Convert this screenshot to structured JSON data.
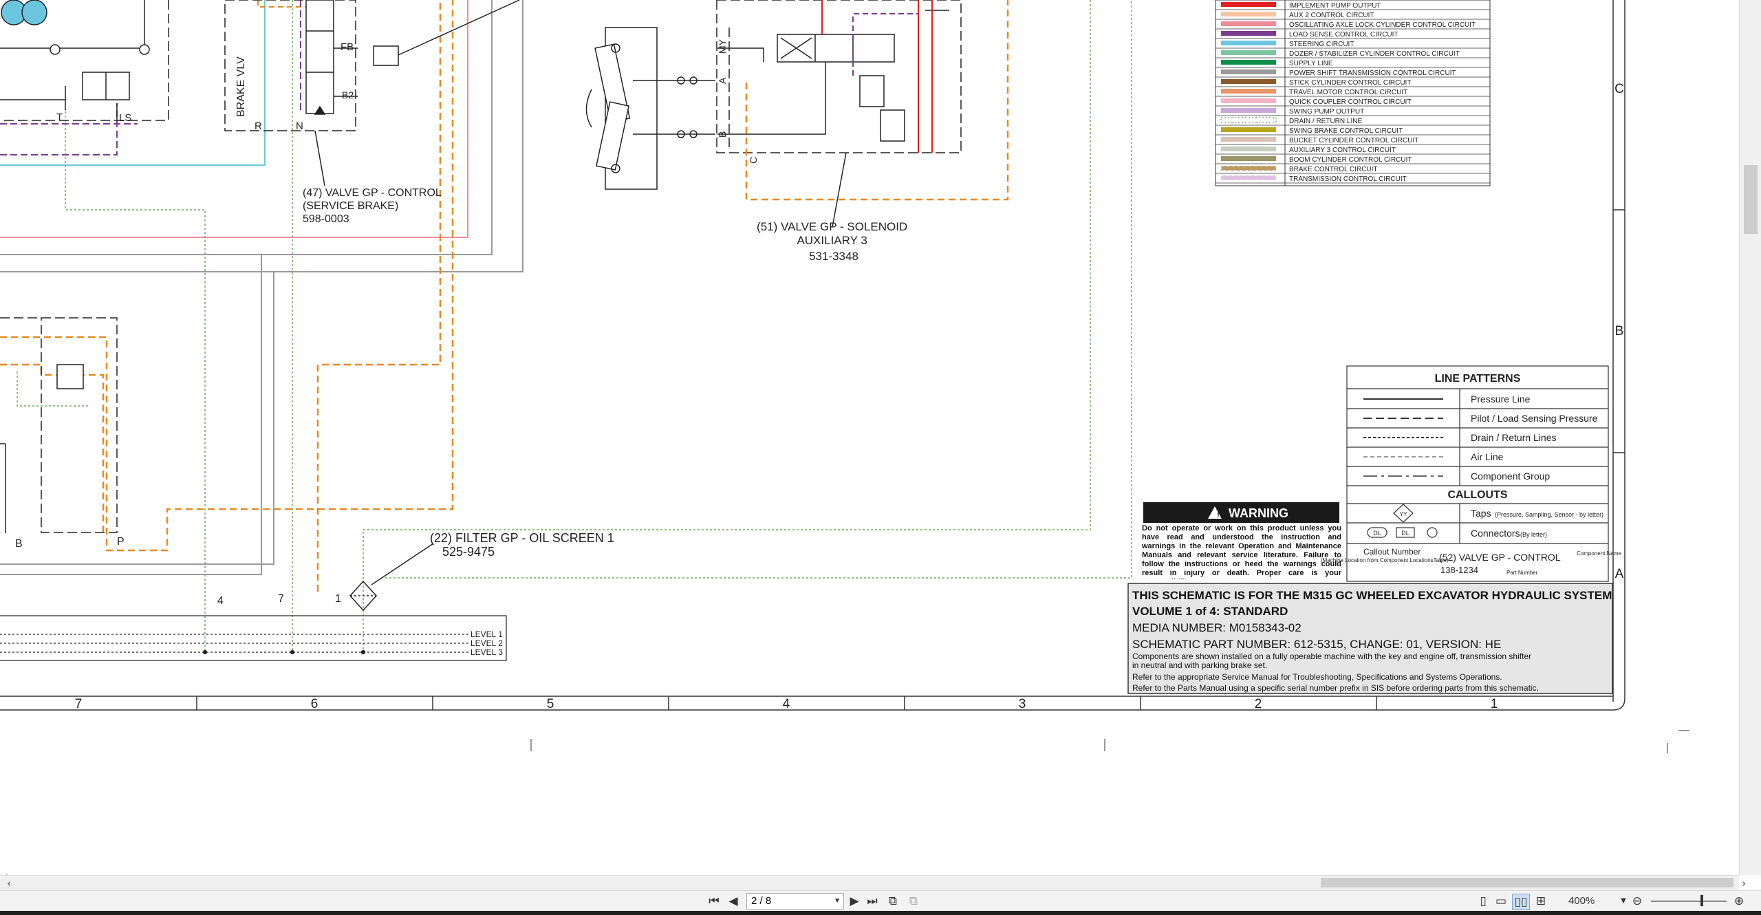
{
  "legend": {
    "items": [
      {
        "label": "IMPLEMENT PUMP OUTPUT",
        "color": "#e31e24",
        "style": "solid"
      },
      {
        "label": "AUX 2 CONTROL CIRCUIT",
        "color": "#f7c6a0",
        "style": "solid"
      },
      {
        "label": "OSCILLATING AXLE LOCK CYLINDER CONTROL CIRCUIT",
        "color": "#f08a9a",
        "style": "solid"
      },
      {
        "label": "LOAD SENSE CONTROL CIRCUIT",
        "color": "#7a3b8f",
        "style": "solid"
      },
      {
        "label": "STEERING CIRCUIT",
        "color": "#6cc6e0",
        "style": "solid"
      },
      {
        "label": "DOZER / STABILIZER CYLINDER CONTROL CIRCUIT",
        "color": "#7cc4a4",
        "style": "solid"
      },
      {
        "label": "SUPPLY LINE",
        "color": "#0b8f4a",
        "style": "solid"
      },
      {
        "label": "POWER SHIFT TRANSMISSION CONTROL CIRCUIT",
        "color": "#9a9a9a",
        "style": "solid"
      },
      {
        "label": "STICK CYLINDER CONTROL CIRCUIT",
        "color": "#8a5a2b",
        "style": "solid"
      },
      {
        "label": "TRAVEL MOTOR CONTROL CIRCUIT",
        "color": "#e8956a",
        "style": "solid"
      },
      {
        "label": "QUICK COUPLER CONTROL CIRCUIT",
        "color": "#f2b3c2",
        "style": "solid"
      },
      {
        "label": "SWING PUMP OUTPUT",
        "color": "#c7a8d8",
        "style": "solid"
      },
      {
        "label": "DRAIN / RETURN LINE",
        "color": "#9cc69a",
        "style": "dotted"
      },
      {
        "label": "SWING BRAKE CONTROL CIRCUIT",
        "color": "#b7a51f",
        "style": "solid"
      },
      {
        "label": "BUCKET CYLINDER CONTROL CIRCUIT",
        "color": "#d9c2b4",
        "style": "solid"
      },
      {
        "label": "AUXILIARY 3 CONTROL CIRCUIT",
        "color": "#c9cdc0",
        "style": "solid"
      },
      {
        "label": "BOOM CYLINDER CONTROL CIRCUIT",
        "color": "#9a9468",
        "style": "solid"
      },
      {
        "label": "BRAKE CONTROL CIRCUIT",
        "color": "#b08a4a",
        "style": "hatched"
      },
      {
        "label": "TRANSMISSION CONTROL CIRCUIT",
        "color": "#d8b6dc",
        "style": "hatched"
      }
    ]
  },
  "line_patterns": {
    "title": "LINE PATTERNS",
    "rows": [
      "Pressure Line",
      "Pilot / Load Sensing Pressure",
      "Drain / Return Lines",
      "Air Line",
      "Component Group"
    ],
    "callouts_title": "CALLOUTS",
    "taps_label": "Taps",
    "taps_note": "(Pressure, Sampling, Sensor - by letter)",
    "taps_symbol": "YY",
    "connectors_label": "Connectors",
    "connectors_note": "(By letter)",
    "conn_symbol_a": "DL",
    "conn_symbol_b": "DL",
    "callout_number_label": "Callout Number",
    "callout_location_note": "(Machine Location from Component LocationsTable)",
    "callout_example": "(52) VALVE GP - CONTROL",
    "callout_example_pn": "138-1234",
    "component_name_label": "Component Name",
    "part_number_label": "Part Number"
  },
  "warning": {
    "title": "WARNING",
    "text": "Do not operate or work on this product unless you have read and understood the instruction and warnings in the relevant Operation and Maintenance Manuals and relevant service literature. Failure to follow the instructions or heed the warnings could result in injury or death. Proper care is your responsibility."
  },
  "title_block": {
    "line1": "THIS SCHEMATIC IS FOR THE M315 GC WHEELED EXCAVATOR HYDRAULIC SYSTEM",
    "line2": "VOLUME 1 of 4: STANDARD",
    "media": "MEDIA NUMBER: M0158343-02",
    "part": "SCHEMATIC PART NUMBER: 612-5315, CHANGE: 01, VERSION: HE",
    "note1": "Components are shown installed on a fully operable machine with the key and engine off, transmission shifter",
    "note2": "in neutral and with parking brake set.",
    "note3": "Refer to the appropriate Service Manual for Troubleshooting, Specifications and Systems Operations.",
    "note4": "Refer to the Parts Manual using a specific serial number prefix in SIS before ordering parts from this schematic."
  },
  "callouts": {
    "brake_valve": [
      "(47) VALVE GP - CONTROL",
      "(SERVICE BRAKE)",
      "598-0003"
    ],
    "solenoid_valve": [
      "(51) VALVE GP - SOLENOID",
      "AUXILIARY 3",
      "531-3348"
    ],
    "filter": [
      "(22) FILTER GP - OIL SCREEN 1",
      "525-9475"
    ]
  },
  "diagram_labels": {
    "brake_vlv": "BRAKE VLV",
    "r": "R",
    "n": "N",
    "fb": "FB",
    "b2": "B2",
    "t": "T",
    "ls": "LS",
    "a": "A",
    "b": "B",
    "my": "MY",
    "c": "C",
    "port_b": "B",
    "port_p": "P",
    "num4": "4",
    "num7": "7",
    "num1": "1"
  },
  "levels": [
    "LEVEL 1",
    "LEVEL 2",
    "LEVEL 3"
  ],
  "grid_columns": [
    "7",
    "6",
    "5",
    "4",
    "3",
    "2",
    "1"
  ],
  "grid_rows": [
    "C",
    "B",
    "A"
  ],
  "toolbar": {
    "page_value": "2 / 8",
    "zoom": "400%"
  }
}
